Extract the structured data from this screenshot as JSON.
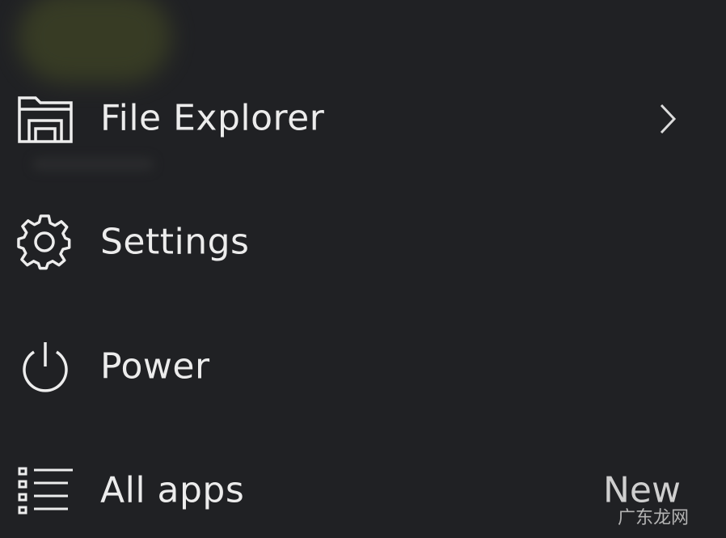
{
  "menu": {
    "items": [
      {
        "label": "File Explorer",
        "icon": "file-explorer-icon",
        "has_submenu": true
      },
      {
        "label": "Settings",
        "icon": "gear-icon"
      },
      {
        "label": "Power",
        "icon": "power-icon"
      },
      {
        "label": "All apps",
        "icon": "all-apps-list-icon",
        "badge": "New"
      }
    ]
  },
  "watermark": {
    "text": "广东龙网"
  },
  "colors": {
    "background": "#202124",
    "text": "#ececec",
    "icon_stroke": "#ededed"
  }
}
